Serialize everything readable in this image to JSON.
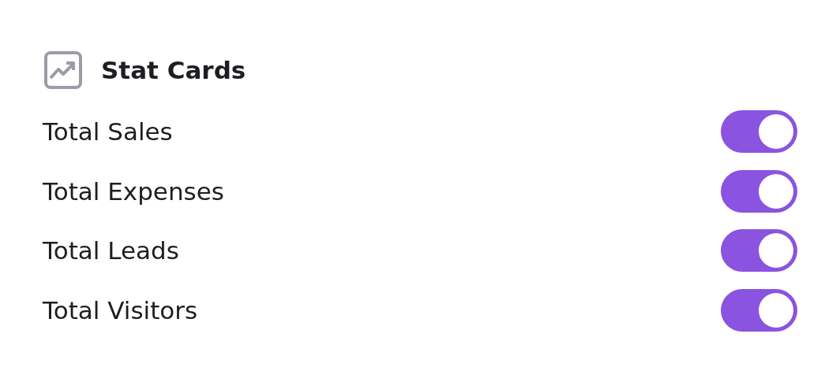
{
  "section": {
    "title": "Stat Cards"
  },
  "toggles": [
    {
      "label": "Total Sales",
      "on": true
    },
    {
      "label": "Total Expenses",
      "on": true
    },
    {
      "label": "Total Leads",
      "on": true
    },
    {
      "label": "Total Visitors",
      "on": true
    }
  ]
}
